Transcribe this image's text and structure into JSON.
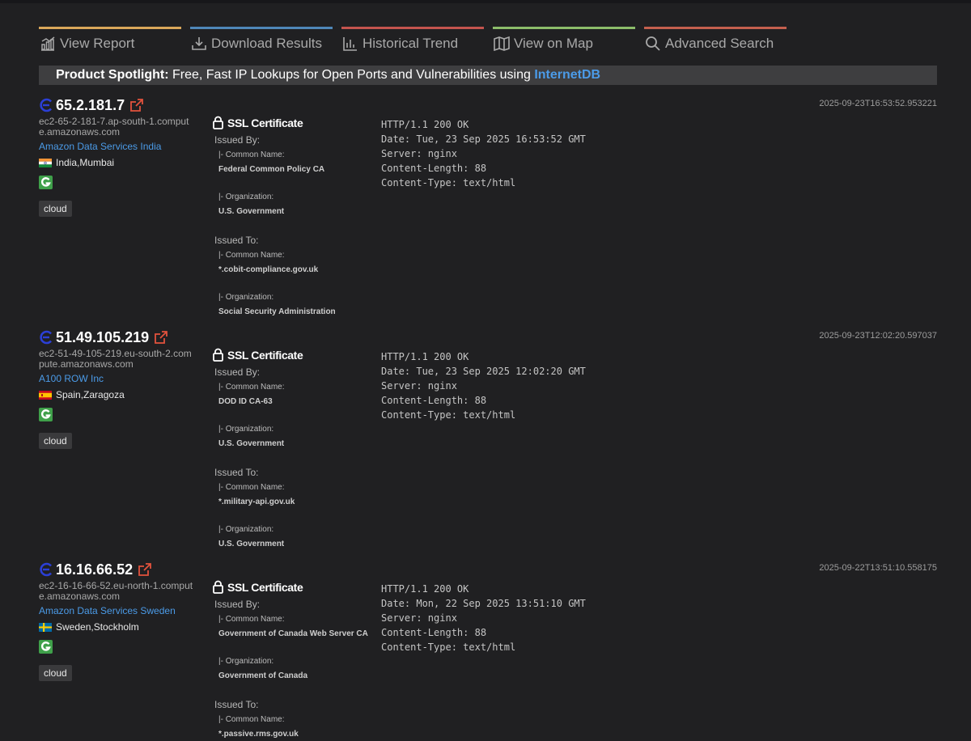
{
  "nav": [
    {
      "label": "View Report",
      "icon": "bar-chart-icon",
      "color": "#d9a75a"
    },
    {
      "label": "Download Results",
      "icon": "download-icon",
      "color": "#4f87b8"
    },
    {
      "label": "Historical Trend",
      "icon": "trend-chart-icon",
      "color": "#c4544e"
    },
    {
      "label": "View on Map",
      "icon": "map-icon",
      "color": "#8cbd6a"
    },
    {
      "label": "Advanced Search",
      "icon": "search-icon",
      "color": "#c4604e"
    }
  ],
  "spotlight": {
    "label": "Product Spotlight:",
    "text": " Free, Fast IP Lookups for Open Ports and Vulnerabilities using ",
    "link": "InternetDB"
  },
  "ssl": {
    "title": "SSL Certificate",
    "issued_by": "Issued By:",
    "issued_to": "Issued To:",
    "common_name": "|- Common Name:",
    "organization": "|- Organization:"
  },
  "colors": {
    "link": "#4b9be8",
    "external_link": "#e2523d",
    "background": "#202022"
  },
  "results": [
    {
      "ip": "65.2.181.7",
      "hostname": "ec2-65-2-181-7.ap-south-1.compute.amazonaws.com",
      "org": "Amazon Data Services India",
      "country": "India",
      "city": "Mumbai",
      "flag": "india-flag-icon",
      "tag": "cloud",
      "timestamp": "2025-09-23T16:53:52.953221",
      "issuer_cn": "Federal Common Policy CA",
      "issuer_org": "U.S. Government",
      "subject_cn": "*.cobit-compliance.gov.uk",
      "subject_org": "Social Security Administration",
      "http": [
        "HTTP/1.1 200 OK",
        "Date: Tue, 23 Sep 2025 16:53:52 GMT",
        "Server: nginx",
        "Content-Length: 88",
        "Content-Type: text/html"
      ]
    },
    {
      "ip": "51.49.105.219",
      "hostname": "ec2-51-49-105-219.eu-south-2.compute.amazonaws.com",
      "org": "A100 ROW Inc",
      "country": "Spain",
      "city": "Zaragoza",
      "flag": "spain-flag-icon",
      "tag": "cloud",
      "timestamp": "2025-09-23T12:02:20.597037",
      "issuer_cn": "DOD ID CA-63",
      "issuer_org": "U.S. Government",
      "subject_cn": "*.military-api.gov.uk",
      "subject_org": "U.S. Government",
      "http": [
        "HTTP/1.1 200 OK",
        "Date: Tue, 23 Sep 2025 12:02:20 GMT",
        "Server: nginx",
        "Content-Length: 88",
        "Content-Type: text/html"
      ]
    },
    {
      "ip": "16.16.66.52",
      "hostname": "ec2-16-16-66-52.eu-north-1.compute.amazonaws.com",
      "org": "Amazon Data Services Sweden",
      "country": "Sweden",
      "city": "Stockholm",
      "flag": "sweden-flag-icon",
      "tag": "cloud",
      "timestamp": "2025-09-22T13:51:10.558175",
      "issuer_cn": "Government of Canada Web Server CA",
      "issuer_org": "Government of Canada",
      "subject_cn": "*.passive.rms.gov.uk",
      "subject_org": "",
      "http": [
        "HTTP/1.1 200 OK",
        "Date: Mon, 22 Sep 2025 13:51:10 GMT",
        "Server: nginx",
        "Content-Length: 88",
        "Content-Type: text/html"
      ]
    }
  ]
}
